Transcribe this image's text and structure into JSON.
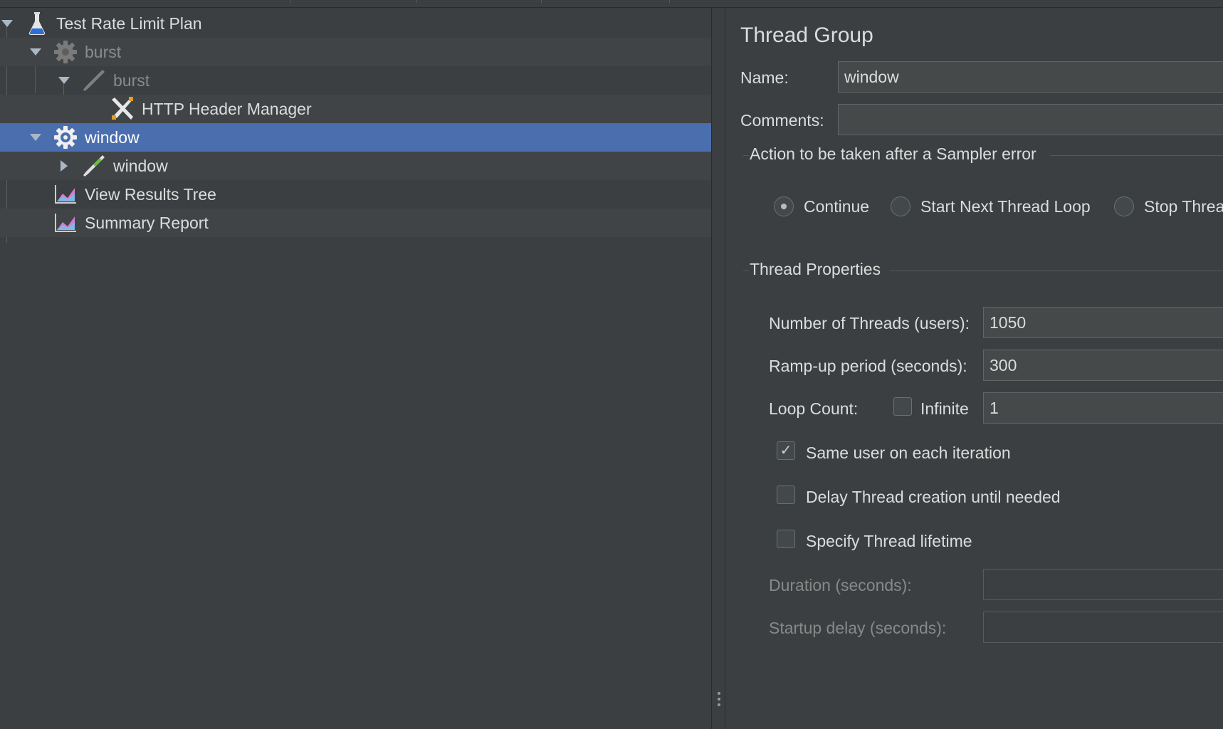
{
  "tree": {
    "items": [
      {
        "label": "Test Rate Limit Plan",
        "icon": "test-plan-flask-icon"
      },
      {
        "label": "burst",
        "icon": "thread-group-gear-icon",
        "disabled": true
      },
      {
        "label": "burst",
        "icon": "sampler-pipette-icon",
        "disabled": true
      },
      {
        "label": "HTTP Header Manager",
        "icon": "config-tools-icon"
      },
      {
        "label": "window",
        "icon": "thread-group-gear-icon",
        "selected": true
      },
      {
        "label": "window",
        "icon": "sampler-pipette-icon"
      },
      {
        "label": "View Results Tree",
        "icon": "listener-chart-icon"
      },
      {
        "label": "Summary Report",
        "icon": "listener-chart-icon"
      }
    ]
  },
  "panel": {
    "title": "Thread Group",
    "name_label": "Name:",
    "name_value": "window",
    "comments_label": "Comments:",
    "comments_value": "",
    "sampler_error": {
      "legend": "Action to be taken after a Sampler error",
      "options": [
        "Continue",
        "Start Next Thread Loop",
        "Stop Threa"
      ],
      "selected": "Continue"
    },
    "thread_properties": {
      "legend": "Thread Properties",
      "threads_label": "Number of Threads (users):",
      "threads_value": "1050",
      "rampup_label": "Ramp-up period (seconds):",
      "rampup_value": "300",
      "loop_label": "Loop Count:",
      "infinite_label": "Infinite",
      "infinite_checked": false,
      "loop_value": "1",
      "same_user_label": "Same user on each iteration",
      "same_user_checked": true,
      "delay_label": "Delay Thread creation until needed",
      "delay_checked": false,
      "lifetime_label": "Specify Thread lifetime",
      "lifetime_checked": false,
      "duration_label": "Duration (seconds):",
      "duration_value": "",
      "startup_label": "Startup delay (seconds):",
      "startup_value": ""
    }
  },
  "colors": {
    "background": "#3c3f41",
    "selection": "#4b6eaf",
    "text": "#dcdcdc",
    "disabled_text": "#888888"
  }
}
